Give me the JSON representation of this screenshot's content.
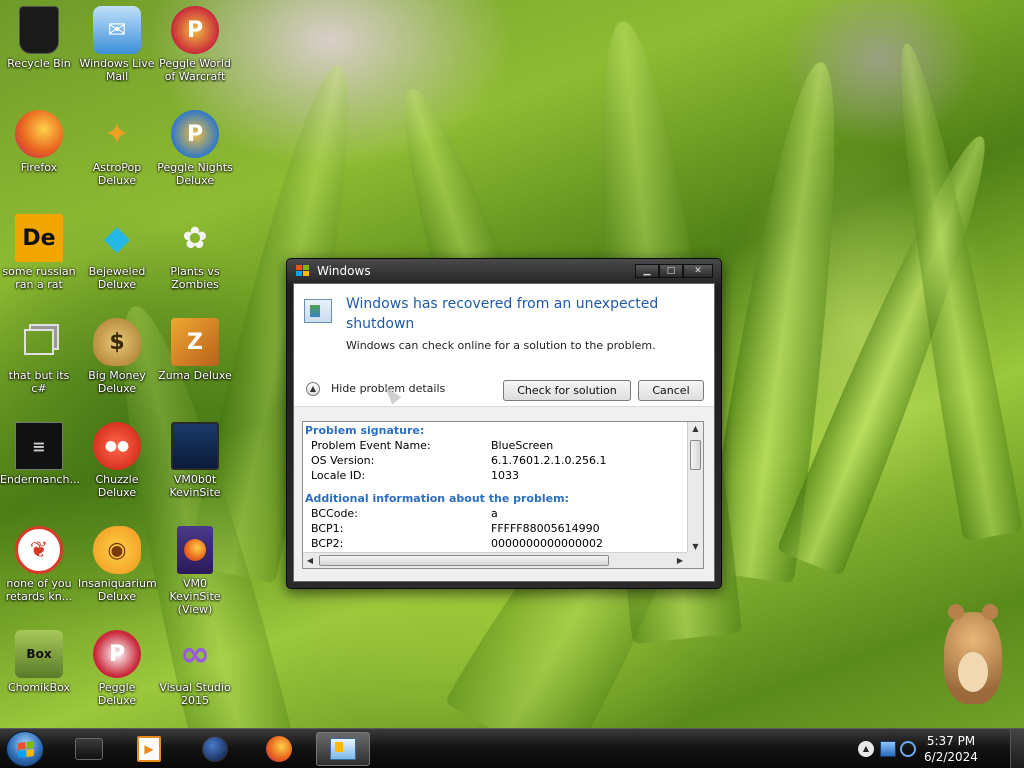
{
  "desktop": {
    "icons": [
      {
        "label": "Recycle Bin",
        "icon": "recycle-bin-icon",
        "color": "#1a1a1a"
      },
      {
        "label": "Windows Live Mail",
        "icon": "mail-icon",
        "color": "#3c8fd8"
      },
      {
        "label": "Peggle World of Warcraft",
        "icon": "peggle-icon",
        "color": "#c9283a"
      },
      {
        "label": "Firefox",
        "icon": "firefox-icon",
        "color": "#e8641c"
      },
      {
        "label": "AstroPop Deluxe",
        "icon": "astropop-icon",
        "color": "#f0a020"
      },
      {
        "label": "Peggle Nights Deluxe",
        "icon": "peggle-icon",
        "color": "#3078c8"
      },
      {
        "label": "some russian ran a rat",
        "icon": "de-logo-icon",
        "color": "#f2a600"
      },
      {
        "label": "Bejeweled Deluxe",
        "icon": "diamond-icon",
        "color": "#24b8e6"
      },
      {
        "label": "Plants vs Zombies",
        "icon": "flower-icon",
        "color": "#6aa83a"
      },
      {
        "label": "that but its c#",
        "icon": "windows-stack-icon",
        "color": "#d0d0d0"
      },
      {
        "label": "Big Money Deluxe",
        "icon": "money-bag-icon",
        "color": "#c89a3c"
      },
      {
        "label": "Zuma Deluxe",
        "icon": "zuma-icon",
        "color": "#d8821c"
      },
      {
        "label": "Endermanch...",
        "icon": "terminal-icon",
        "color": "#111111"
      },
      {
        "label": "Chuzzle Deluxe",
        "icon": "chuzzle-icon",
        "color": "#d82a1a"
      },
      {
        "label": "VM0b0t KevinSite",
        "icon": "monitor-icon",
        "color": "#1a3a6a"
      },
      {
        "label": "none of you retards kn...",
        "icon": "dragon-icon",
        "color": "#d83a2a"
      },
      {
        "label": "Insaniquarium Deluxe",
        "icon": "fish-icon",
        "color": "#f0961c"
      },
      {
        "label": "VM0 KevinSite (View)",
        "icon": "firefox-file-icon",
        "color": "#3a2a7a"
      },
      {
        "label": "ChomikBox",
        "icon": "chomikbox-icon",
        "color": "#7a9a3a"
      },
      {
        "label": "Peggle Deluxe",
        "icon": "peggle-icon",
        "color": "#c9283a"
      },
      {
        "label": "Visual Studio 2015",
        "icon": "visual-studio-icon",
        "color": "#7a3ac8"
      }
    ]
  },
  "dialog": {
    "title": "Windows",
    "headline": "Windows has recovered from an unexpected shutdown",
    "subtext": "Windows can check online for a solution to the problem.",
    "toggle_label": "Hide problem details",
    "check_button": "Check for solution",
    "cancel_button": "Cancel",
    "details": {
      "section1_title": "Problem signature:",
      "section1_rows": [
        {
          "key": "Problem Event Name:",
          "value": "BlueScreen"
        },
        {
          "key": "OS Version:",
          "value": "6.1.7601.2.1.0.256.1"
        },
        {
          "key": "Locale ID:",
          "value": "1033"
        }
      ],
      "section2_title": "Additional information about the problem:",
      "section2_rows": [
        {
          "key": "BCCode:",
          "value": "a"
        },
        {
          "key": "BCP1:",
          "value": "FFFFF88005614990"
        },
        {
          "key": "BCP2:",
          "value": "0000000000000002"
        }
      ]
    }
  },
  "taskbar": {
    "pinned": [
      {
        "name": "taskbar-media-player",
        "color": "#2a2a2a"
      },
      {
        "name": "taskbar-media-center",
        "color": "#e88a1c"
      },
      {
        "name": "taskbar-globe",
        "color": "#1a3a6a"
      },
      {
        "name": "taskbar-firefox",
        "color": "#e8641c"
      },
      {
        "name": "taskbar-problem-reports",
        "color": "#3a8ad8"
      }
    ],
    "clock_time": "5:37 PM",
    "clock_date": "6/2/2024"
  },
  "colors": {
    "accent": "#1e5aa8",
    "details_heading": "#2a6fc0"
  }
}
